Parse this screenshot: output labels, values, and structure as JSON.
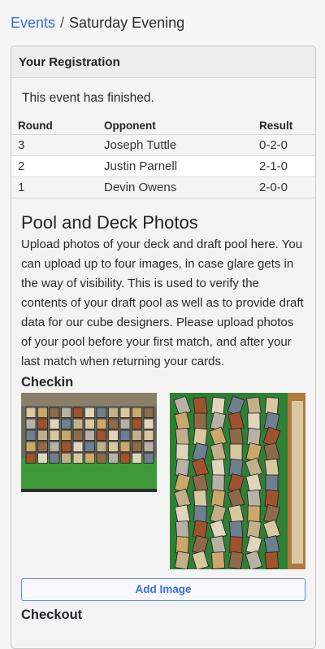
{
  "breadcrumb": {
    "parent": "Events",
    "separator": "/",
    "current": "Saturday Evening"
  },
  "registration": {
    "title": "Your Registration",
    "status": "This event has finished.",
    "columns": [
      "Round",
      "Opponent",
      "Result"
    ],
    "rows": [
      {
        "round": "3",
        "opponent": "Joseph Tuttle",
        "result": "0-2-0"
      },
      {
        "round": "2",
        "opponent": "Justin Parnell",
        "result": "2-1-0"
      },
      {
        "round": "1",
        "opponent": "Devin Owens",
        "result": "2-0-0"
      }
    ]
  },
  "photos": {
    "title": "Pool and Deck Photos",
    "description": "Upload photos of your deck and draft pool here. You can upload up to four images, in case glare gets in the way of visibility. This is used to verify the contents of your draft pool as well as to provide draft data for our cube designers. Please upload photos of your pool before your first match, and after your last match when returning your cards.",
    "checkin_title": "Checkin",
    "add_image_label": "Add Image",
    "checkout_title": "Checkout"
  },
  "colors": {
    "link": "#3a6fd8",
    "mat_green": "#3f9a3a"
  }
}
